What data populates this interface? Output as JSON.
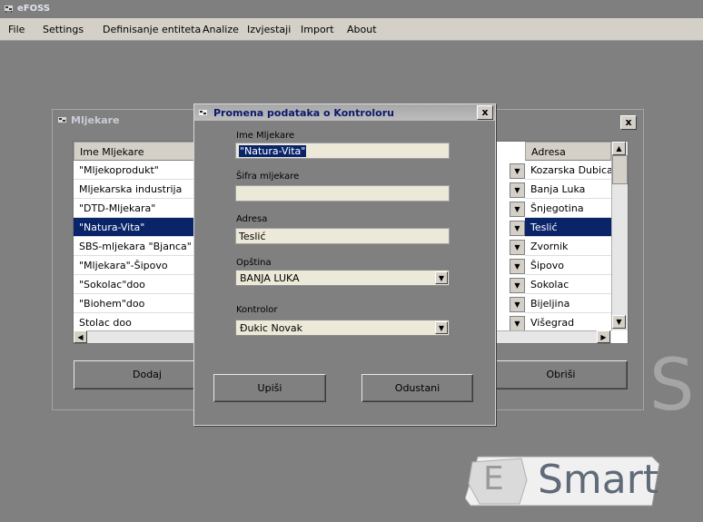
{
  "app": {
    "title": "eFOSS"
  },
  "menu": [
    "File",
    "Settings",
    "Definisanje entiteta",
    "Analize",
    "Izvjestaji",
    "Import",
    "About"
  ],
  "background": {
    "watermark_text": "S",
    "logo_letter": "E",
    "logo_text": "Smart"
  },
  "mljekare_window": {
    "title": "Mljekare",
    "close_label": "x",
    "columns": {
      "name": "Ime Mljekare",
      "address": "Adresa"
    },
    "rows": [
      {
        "name": "\"Mljekoprodukt\"",
        "address": "Kozarska Dubica"
      },
      {
        "name": "Mljekarska industrija",
        "address": "Banja Luka"
      },
      {
        "name": "\"DTD-Mljekara\"",
        "address": "Šnjegotina"
      },
      {
        "name": "\"Natura-Vita\"",
        "address": "Teslić"
      },
      {
        "name": "SBS-mljekara \"Bjanca\"",
        "address": "Zvornik"
      },
      {
        "name": "\"Mljekara\"-Šipovo",
        "address": "Šipovo"
      },
      {
        "name": "\"Sokolac\"doo",
        "address": "Sokolac"
      },
      {
        "name": "\"Biohem\"doo",
        "address": "Bijeljina"
      },
      {
        "name": "Stolac doo",
        "address": "Višegrad"
      }
    ],
    "selected_row": 3,
    "buttons": {
      "add": "Dodaj",
      "delete": "Obriši"
    }
  },
  "dialog": {
    "title": "Promena podataka o Kontroloru",
    "close_label": "x",
    "fields": {
      "name_label": "Ime Mljekare",
      "name_value": "\"Natura-Vita\"",
      "code_label": "Šifra mljekare",
      "code_value": "",
      "address_label": "Adresa",
      "address_value": "Teslić",
      "municipality_label": "Opština",
      "municipality_value": "BANJA LUKA",
      "controller_label": "Kontrolor",
      "controller_value": "Đukic Novak"
    },
    "buttons": {
      "save": "Upiši",
      "cancel": "Odustani"
    }
  },
  "colors": {
    "selection": "#0a246a",
    "desktop": "#808080",
    "menubar": "#d4d0c8"
  }
}
